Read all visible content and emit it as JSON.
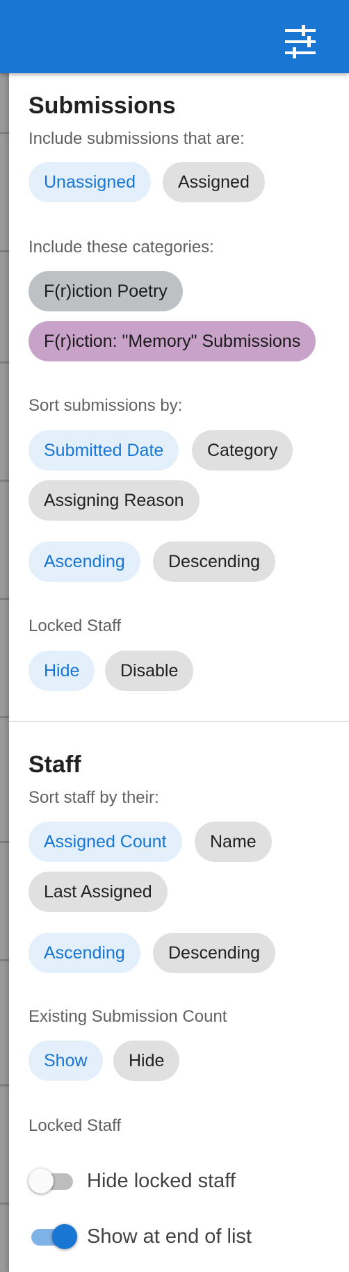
{
  "colors": {
    "appbar": "#1976d2",
    "selected_chip_bg": "#e3f0fc",
    "selected_chip_text": "#1976d2",
    "unselected_chip_bg": "#e0e0e0",
    "category_poetry": "#bdc1c3",
    "category_memory": "#c8a2c8"
  },
  "appbar": {
    "filter_icon": "tune-sliders-icon"
  },
  "submissions": {
    "title": "Submissions",
    "include_label": "Include submissions that are:",
    "include_options": [
      "Unassigned",
      "Assigned"
    ],
    "include_selected": "Unassigned",
    "categories_label": "Include these categories:",
    "categories": [
      "F(r)iction Poetry",
      "F(r)iction: \"Memory\" Submissions"
    ],
    "sort_label": "Sort submissions by:",
    "sort_options": [
      "Submitted Date",
      "Category",
      "Assigning Reason"
    ],
    "sort_selected": "Submitted Date",
    "order_options": [
      "Ascending",
      "Descending"
    ],
    "order_selected": "Ascending",
    "locked_label": "Locked Staff",
    "locked_options": [
      "Hide",
      "Disable"
    ],
    "locked_selected": "Hide"
  },
  "staff": {
    "title": "Staff",
    "sort_label": "Sort staff by their:",
    "sort_options": [
      "Assigned Count",
      "Name",
      "Last Assigned"
    ],
    "sort_selected": "Assigned Count",
    "order_options": [
      "Ascending",
      "Descending"
    ],
    "order_selected": "Ascending",
    "count_label": "Existing Submission Count",
    "count_options": [
      "Show",
      "Hide"
    ],
    "count_selected": "Show",
    "locked_label": "Locked Staff",
    "toggles": [
      {
        "label": "Hide locked staff",
        "on": false
      },
      {
        "label": "Show at end of list",
        "on": true
      }
    ]
  }
}
